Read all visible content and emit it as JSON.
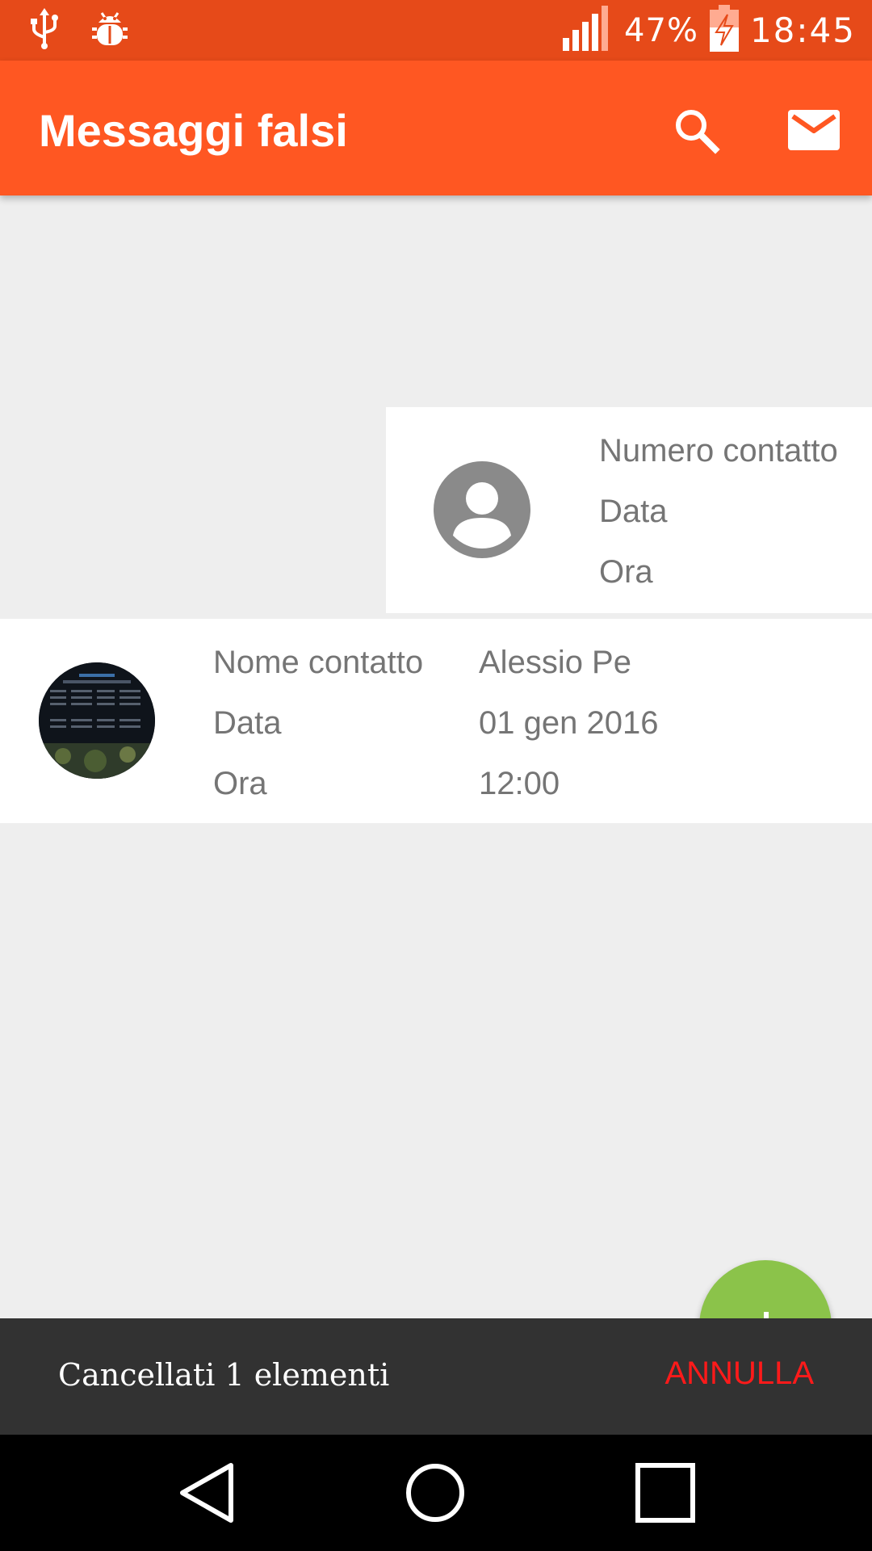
{
  "status_bar": {
    "battery_percent": "47%",
    "time": "18:45",
    "icons": [
      "usb-icon",
      "debug-bug-icon",
      "signal-icon",
      "battery-charging-icon"
    ]
  },
  "app_bar": {
    "title": "Messaggi falsi",
    "actions": [
      "search-icon",
      "mail-icon"
    ]
  },
  "cards": [
    {
      "avatar": "default-person-icon",
      "labels": [
        "Numero contatto",
        "Data",
        "Ora"
      ],
      "values": []
    },
    {
      "avatar": "contact-photo",
      "labels": [
        "Nome contatto",
        "Data",
        "Ora"
      ],
      "values": [
        "Alessio Pe",
        "01 gen 2016",
        "12:00"
      ]
    }
  ],
  "fab": {
    "icon": "add-icon",
    "color": "#8bc34a"
  },
  "snackbar": {
    "message": "Cancellati 1 elementi",
    "action": "ANNULLA",
    "action_color": "#ff1a1a"
  },
  "nav_bar": {
    "buttons": [
      "back-icon",
      "home-icon",
      "recents-icon"
    ]
  },
  "colors": {
    "status_bar": "#e64a19",
    "app_bar": "#ff5722",
    "background": "#eeeeee",
    "text_secondary": "#757575"
  }
}
